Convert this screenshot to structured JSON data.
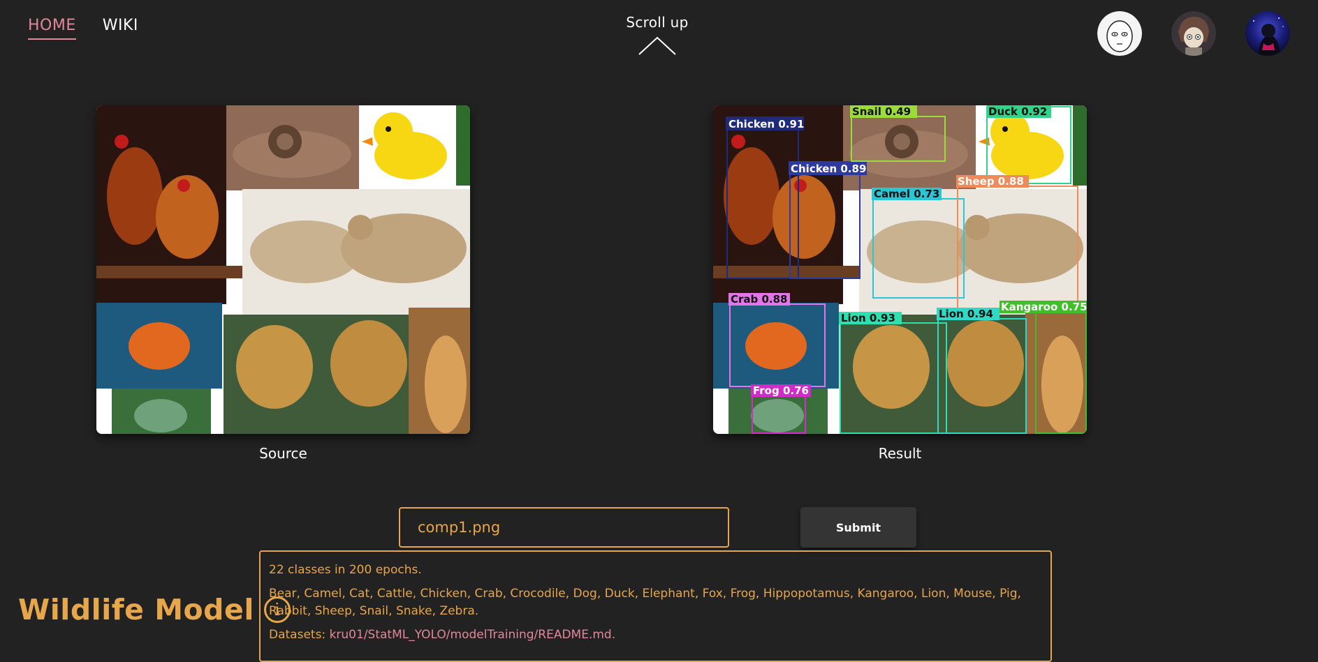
{
  "nav": {
    "items": [
      {
        "label": "HOME",
        "active": true
      },
      {
        "label": "WIKI",
        "active": false
      }
    ]
  },
  "scroll_up": {
    "label": "Scroll up"
  },
  "avatars": [
    {
      "name": "avatar-white-face"
    },
    {
      "name": "avatar-anime-girl"
    },
    {
      "name": "avatar-night-figure"
    }
  ],
  "panels": {
    "source_caption": "Source",
    "result_caption": "Result"
  },
  "detections": [
    {
      "label": "Chicken 0.91",
      "color": "#1f2a7a"
    },
    {
      "label": "Chicken 0.89",
      "color": "#2f3aa0"
    },
    {
      "label": "Snail 0.49",
      "color": "#9bdc3a"
    },
    {
      "label": "Duck 0.92",
      "color": "#2fd48a"
    },
    {
      "label": "Camel 0.73",
      "color": "#29c6d6"
    },
    {
      "label": "Sheep 0.88",
      "color": "#ef8a5a"
    },
    {
      "label": "Crab 0.88",
      "color": "#e276e8"
    },
    {
      "label": "Lion 0.93",
      "color": "#2ee0b0"
    },
    {
      "label": "Lion 0.94",
      "color": "#30d9c4"
    },
    {
      "label": "Kangaroo 0.75",
      "color": "#3fbf2a"
    },
    {
      "label": "Frog 0.76",
      "color": "#d22cc8"
    }
  ],
  "form": {
    "file_value": "comp1.png",
    "submit_label": "Submit"
  },
  "info": {
    "summary": "22 classes in 200 epochs.",
    "classes": "Bear, Camel, Cat, Cattle, Chicken, Crab, Crocodile, Dog, Duck, Elephant, Fox, Frog, Hippopotamus, Kangaroo, Lion, Mouse, Pig, Rabbit, Sheep, Snail, Snake, Zebra.",
    "datasets_label": "Datasets:",
    "datasets_link": "kru01/StatML_YOLO/modelTraining/README.md."
  },
  "brand": {
    "title": "Wildlife Model",
    "info_glyph": "i"
  },
  "colors": {
    "accent_orange": "#e8a64b",
    "accent_pink": "#e3889a",
    "background": "#222222"
  }
}
